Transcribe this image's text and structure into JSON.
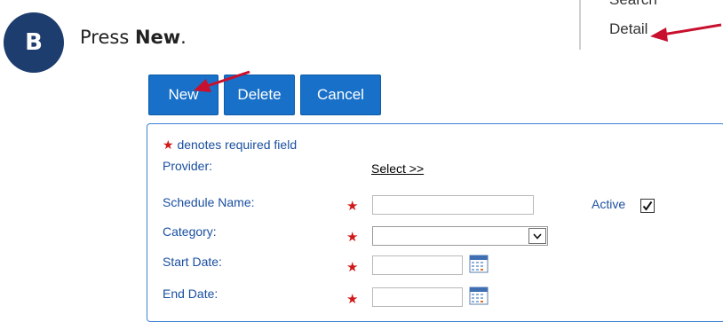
{
  "step": {
    "badge": "B",
    "text_prefix": "Press ",
    "text_bold": "New",
    "text_suffix": "."
  },
  "nav": {
    "search_label": "Search",
    "detail_label": "Detail"
  },
  "toolbar": {
    "new_label": "New",
    "delete_label": "Delete",
    "cancel_label": "Cancel"
  },
  "form": {
    "required_note": "denotes required field",
    "required_star": "★",
    "provider_label": "Provider:",
    "provider_select_link": "Select  >>",
    "schedule_name_label": "Schedule Name:",
    "schedule_name_value": "",
    "active_label": "Active",
    "active_checked": true,
    "category_label": "Category:",
    "category_value": "",
    "start_date_label": "Start Date:",
    "start_date_value": "",
    "end_date_label": "End Date:",
    "end_date_value": ""
  },
  "colors": {
    "button_blue": "#1870c8",
    "label_blue": "#1a4fa0",
    "required_red": "#d01818",
    "badge_navy": "#1d3d6e",
    "arrow_red": "#c8102e",
    "panel_border": "#3b83d3"
  }
}
